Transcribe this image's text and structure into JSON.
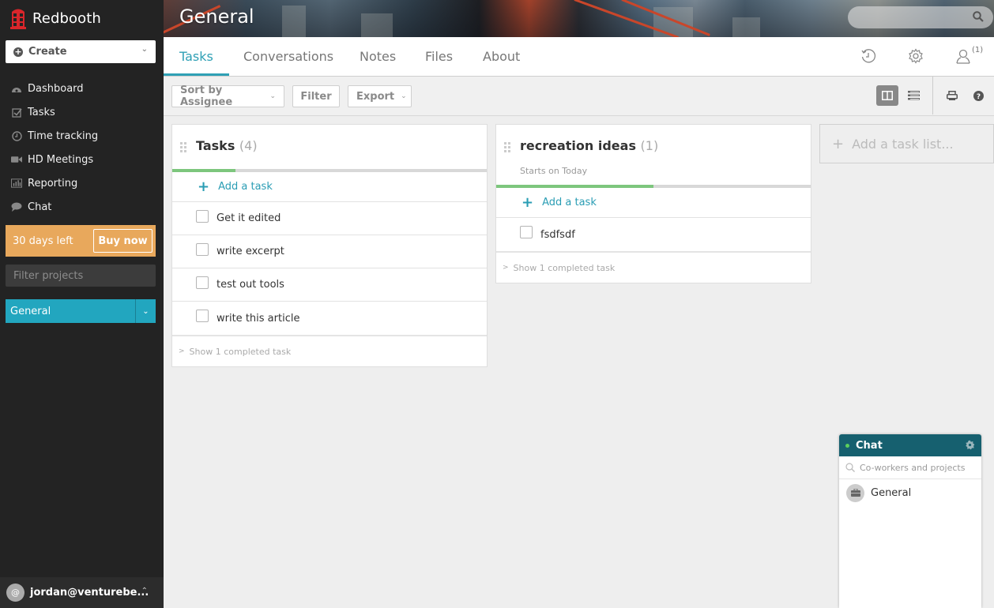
{
  "app": {
    "brand": "Redbooth"
  },
  "sidebar": {
    "create_label": "Create",
    "nav": [
      {
        "label": "Dashboard",
        "icon": "dashboard-icon"
      },
      {
        "label": "Tasks",
        "icon": "tasks-checkbox-icon"
      },
      {
        "label": "Time tracking",
        "icon": "clock-icon"
      },
      {
        "label": "HD Meetings",
        "icon": "video-camera-icon"
      },
      {
        "label": "Reporting",
        "icon": "bar-chart-icon"
      },
      {
        "label": "Chat",
        "icon": "speech-bubble-icon"
      }
    ],
    "trial": {
      "text": "30 days left",
      "buy_label": "Buy now"
    },
    "filter_placeholder": "Filter projects",
    "project_selected": "General",
    "user": {
      "avatar": "@",
      "email": "jordan@venturebe..."
    }
  },
  "header": {
    "project_title": "General",
    "search_placeholder": "",
    "tabs": [
      {
        "label": "Tasks",
        "active": true
      },
      {
        "label": "Conversations",
        "active": false
      },
      {
        "label": "Notes",
        "active": false
      },
      {
        "label": "Files",
        "active": false
      },
      {
        "label": "About",
        "active": false
      }
    ],
    "people_badge": "(1)"
  },
  "toolbar": {
    "sort_label": "Sort by Assignee",
    "filter_label": "Filter",
    "export_label": "Export",
    "view_mode": "columns"
  },
  "task_lists": [
    {
      "title": "Tasks",
      "count": "(4)",
      "subtitle": "",
      "progress": 0.2,
      "add_label": "Add a task",
      "tasks": [
        "Get it edited",
        "write excerpt",
        "test out tools",
        "write this article"
      ],
      "completed_label": "Show 1 completed task"
    },
    {
      "title": "recreation ideas",
      "count": "(1)",
      "subtitle": "Starts on Today",
      "progress": 0.5,
      "add_label": "Add a task",
      "tasks": [
        "fsdfsdf"
      ],
      "completed_label": "Show 1 completed task"
    }
  ],
  "add_list_label": "Add a task list...",
  "chat": {
    "title": "Chat",
    "status_color": "#5cd05c",
    "search_placeholder": "Co-workers and projects",
    "items": [
      {
        "name": "General",
        "icon": "briefcase-icon"
      }
    ]
  },
  "colors": {
    "accent": "#2fa0b5",
    "trial": "#e8a85c",
    "project": "#22a6bf",
    "chat_header": "#16606f",
    "progress": "#7dc67d"
  }
}
